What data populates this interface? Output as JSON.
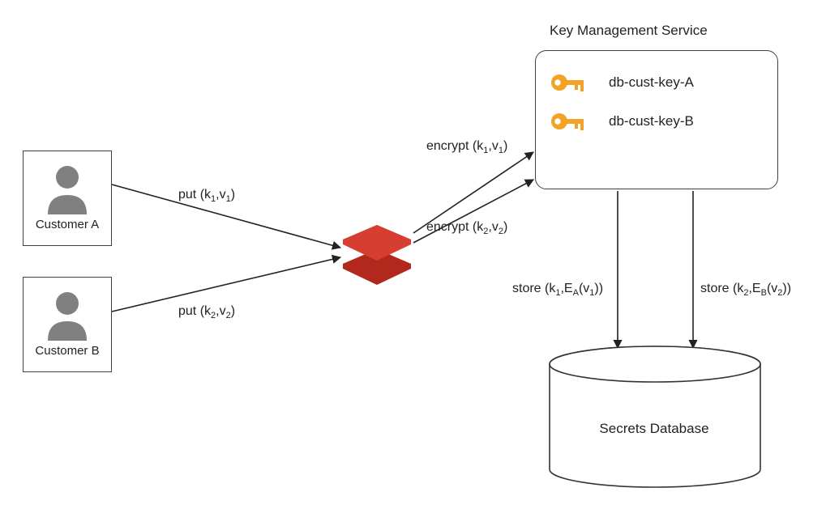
{
  "title_kms": "Key Management Service",
  "customers": {
    "a": {
      "label": "Customer A"
    },
    "b": {
      "label": "Customer B"
    }
  },
  "kms_keys": {
    "a": "db-cust-key-A",
    "b": "db-cust-key-B"
  },
  "edges": {
    "put_a": {
      "op": "put",
      "args_html": "(k<sub>1</sub>,v<sub>1</sub>)"
    },
    "put_b": {
      "op": "put",
      "args_html": "(k<sub>2</sub>,v<sub>2</sub>)"
    },
    "enc_a": {
      "op": "encrypt",
      "args_html": "(k<sub>1</sub>,v<sub>1</sub>)"
    },
    "enc_b": {
      "op": "encrypt",
      "args_html": "(k<sub>2</sub>,v<sub>2</sub>)"
    },
    "store_a": {
      "op": "store",
      "args_html": "(k<sub>1</sub>,E<sub>A</sub>(v<sub>1</sub>))"
    },
    "store_b": {
      "op": "store",
      "args_html": "(k<sub>2</sub>,E<sub>B</sub>(v<sub>2</sub>))"
    }
  },
  "secrets_db_label": "Secrets Database",
  "colors": {
    "red": "#e63b2e",
    "red_dark": "#c72f23",
    "orange": "#f2a224",
    "gray": "#808080"
  }
}
